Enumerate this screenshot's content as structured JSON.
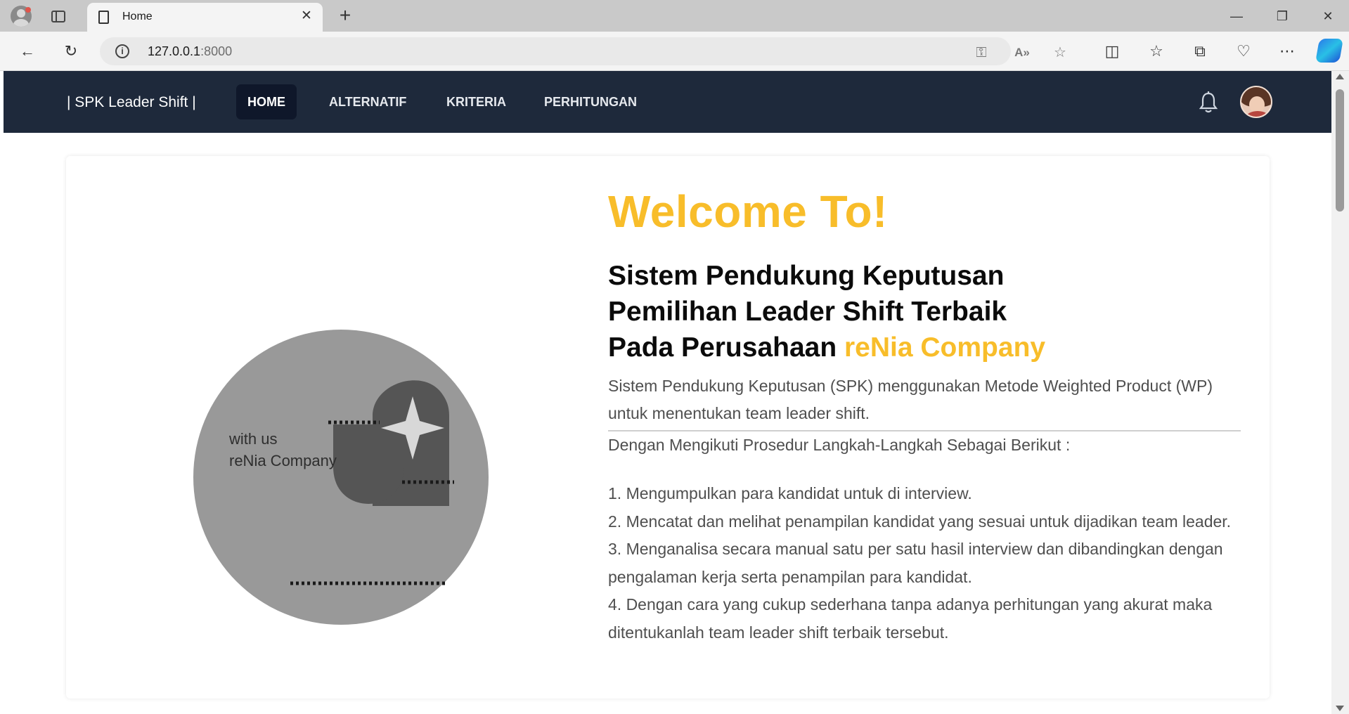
{
  "browser": {
    "tab_title": "Home",
    "url_host": "127.0.0.1",
    "url_port": ":8000"
  },
  "navbar": {
    "brand": "| SPK Leader Shift |",
    "items": [
      {
        "label": "HOME",
        "active": true
      },
      {
        "label": "ALTERNATIF",
        "active": false
      },
      {
        "label": "KRITERIA",
        "active": false
      },
      {
        "label": "PERHITUNGAN",
        "active": false
      }
    ]
  },
  "hero": {
    "welcome": "Welcome To!",
    "headline_line1": "Sistem Pendukung Keputusan",
    "headline_line2": "Pemilihan Leader Shift Terbaik",
    "headline_line3_prefix": "Pada Perusahaan ",
    "headline_company": "reNia Company",
    "description": "Sistem Pendukung Keputusan (SPK) menggunakan Metode Weighted Product (WP) untuk menentukan team leader shift.",
    "intro": "Dengan Mengikuti Prosedur Langkah-Langkah Sebagai Berikut :",
    "steps": [
      "1. Mengumpulkan para kandidat untuk di interview.",
      "2. Mencatat dan melihat penampilan kandidat yang sesuai untuk dijadikan team leader.",
      "3. Menganalisa secara manual satu per satu hasil interview dan dibandingkan dengan pengalaman kerja serta penampilan para kandidat.",
      "4. Dengan cara yang cukup sederhana tanpa adanya perhitungan yang akurat maka ditentukanlah team leader shift terbaik tersebut."
    ]
  },
  "illustration": {
    "line1": "with us",
    "line2": "reNia Company"
  },
  "colors": {
    "navbar_bg": "#1e293b",
    "accent": "#f8bd2a",
    "active_nav_bg": "#0f172a"
  }
}
